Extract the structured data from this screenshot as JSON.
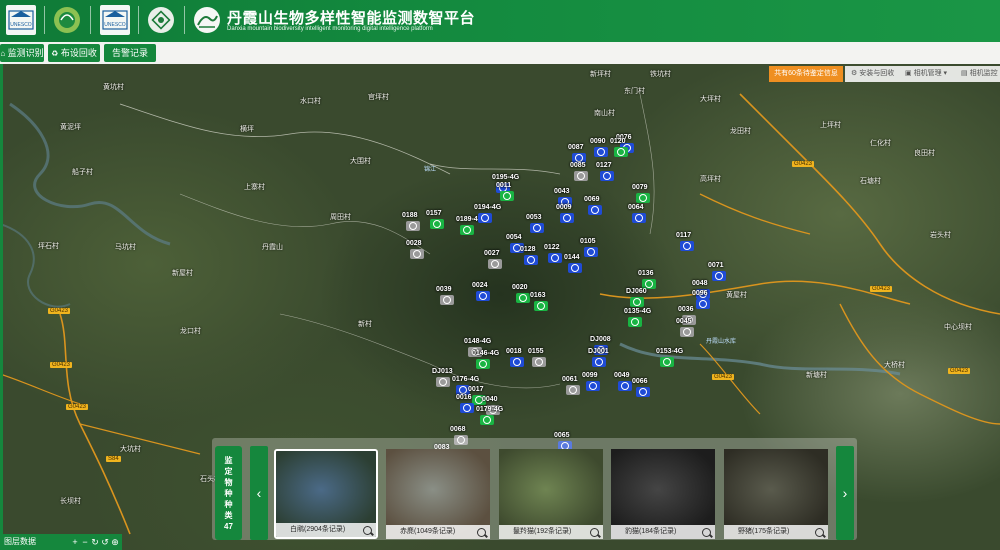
{
  "header": {
    "title_zh": "丹霞山生物多样性智能监测数智平台",
    "title_en": "Danxia mountain biodiversity intelligent monitoring digital intelligence platform",
    "logos": [
      "unesco-logo",
      "geopark-logo",
      "unesco-logo-2",
      "heritage-logo",
      "danxia-logo"
    ]
  },
  "nav": {
    "items": [
      {
        "label": "监测识别",
        "icon": "home-icon"
      },
      {
        "label": "布设回收",
        "icon": "recycle-icon"
      },
      {
        "label": "告警记录",
        "icon": ""
      }
    ]
  },
  "toolbar": {
    "notice": "共有60条待鉴定信息",
    "buttons": [
      {
        "label": "安装与回收",
        "icon": "gear-icon"
      },
      {
        "label": "相机管理",
        "icon": "camera-icon"
      },
      {
        "label": "相机监控",
        "icon": "monitor-icon"
      }
    ]
  },
  "map": {
    "colors": {
      "green": "#19b443",
      "blue": "#1f4bd6",
      "gray": "#9a9a9a",
      "road": "#f0b41e"
    },
    "places": [
      {
        "name": "黄坑村"
      },
      {
        "name": "新坪村"
      },
      {
        "name": "铁坑村"
      },
      {
        "name": "东门村"
      },
      {
        "name": "南山村"
      },
      {
        "name": "大坪村"
      },
      {
        "name": "龙田村"
      },
      {
        "name": "黄泥坪"
      },
      {
        "name": "船子村"
      },
      {
        "name": "水口村"
      },
      {
        "name": "官坪村"
      },
      {
        "name": "大围村"
      },
      {
        "name": "横坪"
      },
      {
        "name": "马坑村"
      },
      {
        "name": "新屋村"
      },
      {
        "name": "坪石村"
      },
      {
        "name": "丹霞山"
      },
      {
        "name": "周田村"
      },
      {
        "name": "上寨村"
      },
      {
        "name": "龙口村"
      },
      {
        "name": "新村"
      },
      {
        "name": "大坑村"
      },
      {
        "name": "石头村"
      },
      {
        "name": "长坝村"
      },
      {
        "name": "上坪村"
      },
      {
        "name": "仁化村"
      },
      {
        "name": "良田村"
      },
      {
        "name": "石塘村"
      },
      {
        "name": "中心坝村"
      },
      {
        "name": "大桥村"
      },
      {
        "name": "岩头村"
      },
      {
        "name": "黄屋村"
      },
      {
        "name": "新塘村"
      },
      {
        "name": "高坪村"
      }
    ],
    "road_badges": [
      "G0423",
      "G0423",
      "G0423",
      "G0423",
      "G0423",
      "G0423",
      "S84",
      "G0423"
    ],
    "water_labels": [
      "锦江",
      "丹霞山水库"
    ],
    "cameras": [
      {
        "id": "0076",
        "color": "blue"
      },
      {
        "id": "0090",
        "color": "blue"
      },
      {
        "id": "0120",
        "color": "green"
      },
      {
        "id": "0087",
        "color": "blue"
      },
      {
        "id": "0085",
        "color": "gray"
      },
      {
        "id": "0127",
        "color": "blue"
      },
      {
        "id": "0195-4G",
        "color": "blue"
      },
      {
        "id": "0011",
        "color": "green"
      },
      {
        "id": "0043",
        "color": "blue"
      },
      {
        "id": "0079",
        "color": "green"
      },
      {
        "id": "0069",
        "color": "blue"
      },
      {
        "id": "0064",
        "color": "blue"
      },
      {
        "id": "0157",
        "color": "green"
      },
      {
        "id": "0188",
        "color": "gray"
      },
      {
        "id": "0189-4G",
        "color": "green"
      },
      {
        "id": "0194-4G",
        "color": "blue"
      },
      {
        "id": "0053",
        "color": "blue"
      },
      {
        "id": "0009",
        "color": "blue"
      },
      {
        "id": "0028",
        "color": "gray"
      },
      {
        "id": "0054",
        "color": "blue"
      },
      {
        "id": "0122",
        "color": "blue"
      },
      {
        "id": "0105",
        "color": "blue"
      },
      {
        "id": "0117",
        "color": "blue"
      },
      {
        "id": "0071",
        "color": "blue"
      },
      {
        "id": "0027",
        "color": "gray"
      },
      {
        "id": "0128",
        "color": "blue"
      },
      {
        "id": "0144",
        "color": "blue"
      },
      {
        "id": "0136",
        "color": "green"
      },
      {
        "id": "0048",
        "color": "blue"
      },
      {
        "id": "0039",
        "color": "gray"
      },
      {
        "id": "0024",
        "color": "blue"
      },
      {
        "id": "0020",
        "color": "green"
      },
      {
        "id": "0163",
        "color": "green"
      },
      {
        "id": "DJ060",
        "color": "green"
      },
      {
        "id": "0096",
        "color": "blue"
      },
      {
        "id": "0135-4G",
        "color": "green"
      },
      {
        "id": "0036",
        "color": "gray"
      },
      {
        "id": "0045",
        "color": "gray"
      },
      {
        "id": "0148-4G",
        "color": "gray"
      },
      {
        "id": "0146-4G",
        "color": "green"
      },
      {
        "id": "0018",
        "color": "blue"
      },
      {
        "id": "0155",
        "color": "gray"
      },
      {
        "id": "DJ008",
        "color": "blue"
      },
      {
        "id": "DJ001",
        "color": "blue"
      },
      {
        "id": "0153-4G",
        "color": "green"
      },
      {
        "id": "DJ013",
        "color": "gray"
      },
      {
        "id": "0176-4G",
        "color": "blue"
      },
      {
        "id": "0061",
        "color": "gray"
      },
      {
        "id": "0099",
        "color": "blue"
      },
      {
        "id": "0049",
        "color": "blue"
      },
      {
        "id": "0066",
        "color": "blue"
      },
      {
        "id": "0017",
        "color": "green"
      },
      {
        "id": "0016",
        "color": "blue"
      },
      {
        "id": "0040",
        "color": "gray"
      },
      {
        "id": "0179-4G",
        "color": "green"
      },
      {
        "id": "0068",
        "color": "gray"
      },
      {
        "id": "0065",
        "color": "blue"
      },
      {
        "id": "0083",
        "color": "gray"
      }
    ]
  },
  "gallery": {
    "species_tag": "监定物种种类47",
    "species_count": "47",
    "prev_icon": "chevron-left-icon",
    "next_icon": "chevron-right-icon",
    "cards": [
      {
        "label": "白鹇(2904条记录)",
        "active": true,
        "tone": [
          "#4b6a87",
          "#2c3f33"
        ]
      },
      {
        "label": "赤麂(1049条记录)",
        "active": false,
        "tone": [
          "#8a8f86",
          "#5c5040"
        ]
      },
      {
        "label": "鬣羚猫(192条记录)",
        "active": false,
        "tone": [
          "#6f8452",
          "#3e4a2e"
        ]
      },
      {
        "label": "豹猫(184条记录)",
        "active": false,
        "tone": [
          "#454545",
          "#1d1d1d"
        ]
      },
      {
        "label": "野猪(175条记录)",
        "active": false,
        "tone": [
          "#5a5b4d",
          "#2e2d24"
        ]
      }
    ]
  },
  "layer_panel": {
    "title": "图层数据",
    "icons": [
      "plus-icon",
      "minus-icon",
      "refresh-icon",
      "reset-icon",
      "locate-icon"
    ]
  }
}
